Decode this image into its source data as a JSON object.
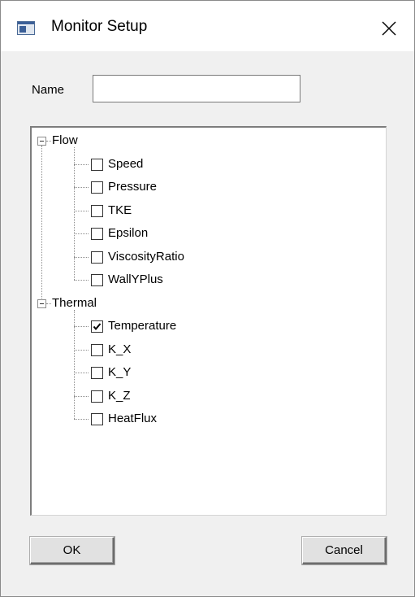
{
  "window": {
    "title": "Monitor Setup",
    "app_icon": "window-app-icon",
    "close_icon": "close-icon"
  },
  "form": {
    "name_label": "Name",
    "name_value": "",
    "name_placeholder": ""
  },
  "tree": {
    "groups": [
      {
        "label": "Flow",
        "expanded": true,
        "items": [
          {
            "label": "Speed",
            "checked": false
          },
          {
            "label": "Pressure",
            "checked": false
          },
          {
            "label": "TKE",
            "checked": false
          },
          {
            "label": "Epsilon",
            "checked": false
          },
          {
            "label": "ViscosityRatio",
            "checked": false
          },
          {
            "label": "WallYPlus",
            "checked": false
          }
        ]
      },
      {
        "label": "Thermal",
        "expanded": true,
        "items": [
          {
            "label": "Temperature",
            "checked": true
          },
          {
            "label": "K_X",
            "checked": false
          },
          {
            "label": "K_Y",
            "checked": false
          },
          {
            "label": "K_Z",
            "checked": false
          },
          {
            "label": "HeatFlux",
            "checked": false
          }
        ]
      }
    ]
  },
  "buttons": {
    "ok_label": "OK",
    "cancel_label": "Cancel"
  }
}
